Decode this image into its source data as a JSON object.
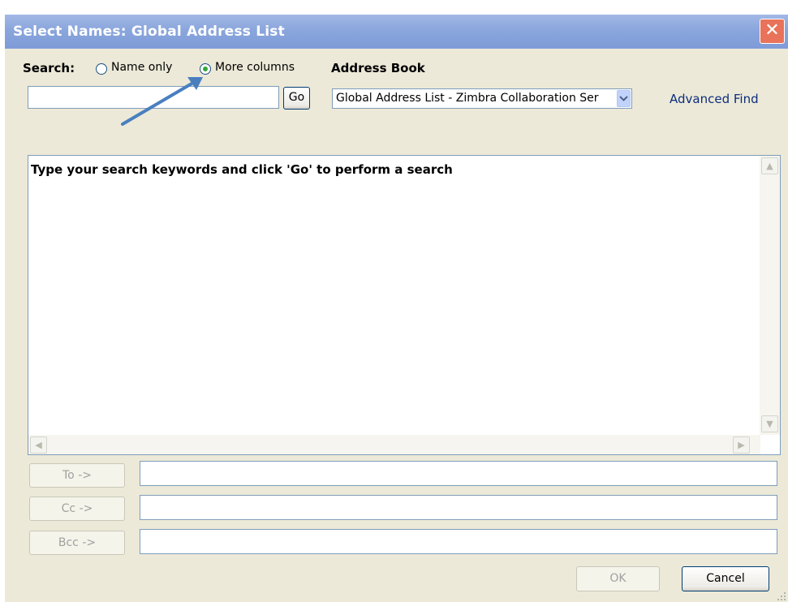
{
  "window": {
    "title": "Select Names: Global Address List",
    "close_glyph": "✕"
  },
  "search": {
    "label": "Search:",
    "options": [
      {
        "label": "Name only",
        "checked": false
      },
      {
        "label": "More columns",
        "checked": true
      }
    ],
    "input_value": "",
    "go_label": "Go"
  },
  "address_book": {
    "label": "Address Book",
    "selected": "Global Address List - Zimbra Collaboration Ser"
  },
  "advanced_find": "Advanced Find",
  "results": {
    "message": "Type your search keywords and click 'Go' to perform a search"
  },
  "recipients": [
    {
      "label": "To ->",
      "value": ""
    },
    {
      "label": "Cc ->",
      "value": ""
    },
    {
      "label": "Bcc ->",
      "value": ""
    }
  ],
  "buttons": {
    "ok": "OK",
    "cancel": "Cancel"
  },
  "colors": {
    "title_bar": "#8aa6dc",
    "dialog_bg": "#ece9d8",
    "close_button": "#e8735a",
    "annotation_arrow": "#4a7fbf",
    "radio_selected": "#35a635",
    "link": "#0b2d7c"
  }
}
